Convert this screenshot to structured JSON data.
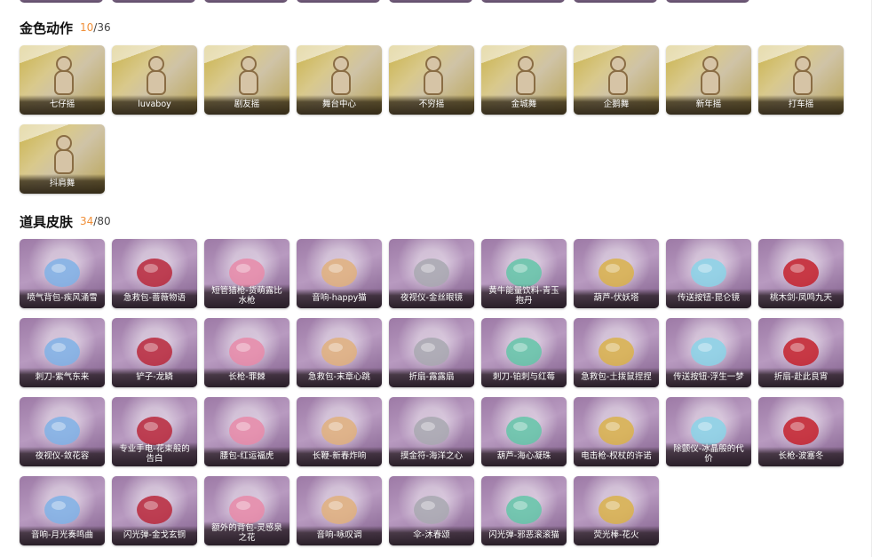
{
  "sections": [
    {
      "title": "金色动作",
      "owned": "10",
      "total": "/36",
      "items": [
        "七仔摇",
        "luvaboy",
        "剧友摇",
        "舞台中心",
        "不穷摇",
        "金城舞",
        "企鹅舞",
        "新年摇",
        "打车摇",
        "抖肩舞"
      ]
    },
    {
      "title": "道具皮肤",
      "owned": "34",
      "total": "/80",
      "items": [
        "喷气背包-疾风涌雪",
        "急救包-蔷薇物语",
        "短管猎枪-货萌露比水枪",
        "音响-happy猫",
        "夜视仪-金丝眼镜",
        "黄牛能量饮料-青玉抱丹",
        "葫芦-伏妖塔",
        "传送按钮-昆仑镜",
        "桃木剑-凤鸣九天",
        "刺刀-紫气东来",
        "铲子-龙鳞",
        "长枪-罪棘",
        "急救包-末章心跳",
        "折扇-露露扇",
        "刺刀-铂刺与红莓",
        "急救包-土拨鼠捏捏",
        "传送按钮-浮生一梦",
        "折扇-赴此良宵",
        "夜视仪-敛花容",
        "专业手电-花束般的告白",
        "腰包-红运福虎",
        "长鞭-新春炸响",
        "摸金符-海洋之心",
        "葫芦-海心凝珠",
        "电击枪-权杖的许诺",
        "除颤仪-冰晶般的代价",
        "长枪-波塞冬",
        "音响-月光奏鸣曲",
        "闪光弹-金戈玄铜",
        "额外的背包-灵感泉之花",
        "音响-咏叹调",
        "伞-沐春颂",
        "闪光弹-邪恶滚滚猫",
        "荧光棒-花火"
      ]
    }
  ]
}
